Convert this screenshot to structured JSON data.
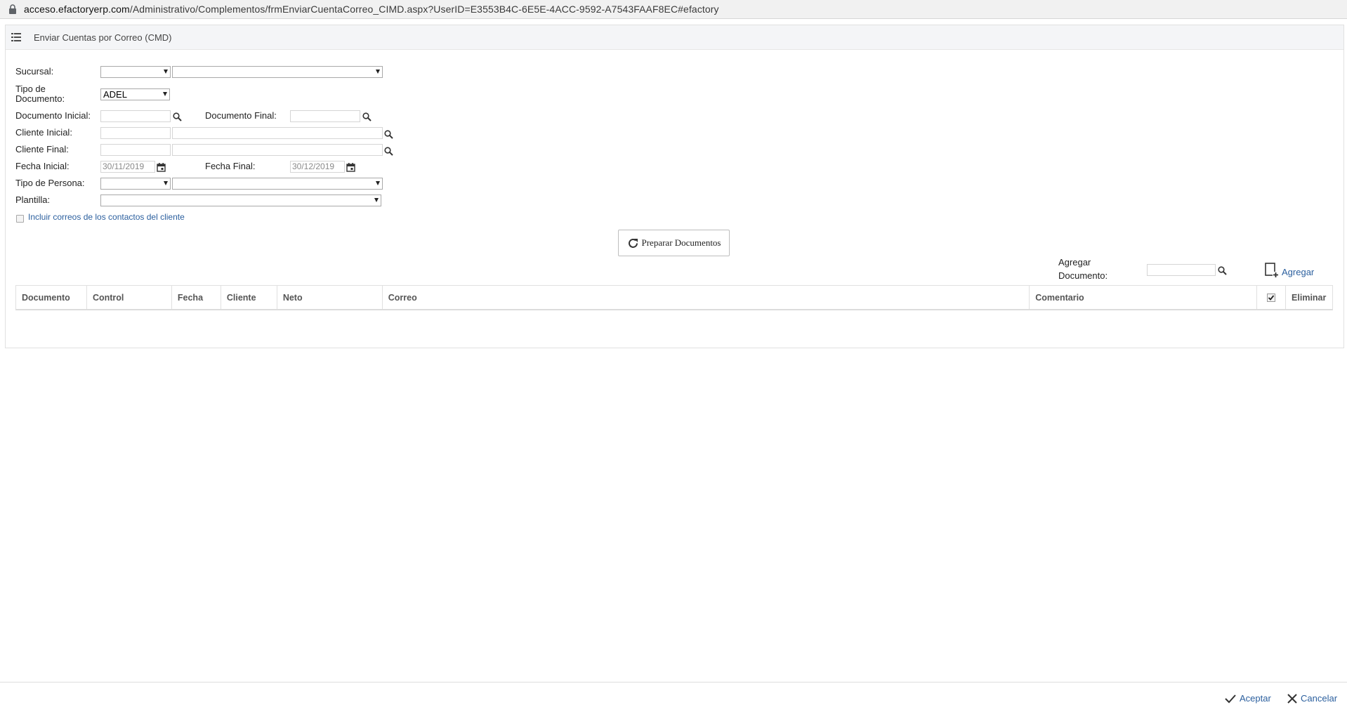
{
  "browser": {
    "url_host": "acceso.efactoryerp.com",
    "url_path": "/Administrativo/Complementos/frmEnviarCuentaCorreo_CIMD.aspx?UserID=E3553B4C-6E5E-4ACC-9592-A7543FAAF8EC#efactory"
  },
  "panel": {
    "title": "Enviar Cuentas por Correo (CMD)"
  },
  "form": {
    "sucursal_label": "Sucursal:",
    "sucursal_code": "",
    "sucursal_name": "",
    "tipo_documento_label_1": "Tipo de",
    "tipo_documento_label_2": "Documento:",
    "tipo_documento_value": "ADEL",
    "documento_inicial_label": "Documento Inicial:",
    "documento_inicial_value": "",
    "documento_final_label": "Documento Final:",
    "documento_final_value": "",
    "cliente_inicial_label": "Cliente Inicial:",
    "cliente_final_label": "Cliente Final:",
    "fecha_inicial_label": "Fecha Inicial:",
    "fecha_inicial_value": "30/11/2019",
    "fecha_final_label": "Fecha Final:",
    "fecha_final_value": "30/12/2019",
    "tipo_persona_label": "Tipo de Persona:",
    "plantilla_label": "Plantilla:",
    "incluir_correos_label": "Incluir correos de los contactos del cliente",
    "incluir_correos_checked": false
  },
  "actions": {
    "preparar_label": "Preparar Documentos",
    "agregar_documento_label_1": "Agregar",
    "agregar_documento_label_2": "Documento:",
    "agregar_label": "Agregar"
  },
  "table": {
    "columns": [
      "Documento",
      "Control",
      "Fecha",
      "Cliente",
      "Neto",
      "Correo",
      "Comentario",
      "",
      "Eliminar"
    ],
    "rows": []
  },
  "footer": {
    "aceptar_label": "Aceptar",
    "cancelar_label": "Cancelar"
  },
  "icons": {
    "menu": "list-icon",
    "search": "magnifier-icon",
    "calendar": "calendar-icon",
    "refresh": "refresh-icon",
    "add_document": "add-document-icon",
    "check": "checkmark-icon",
    "close": "x-icon"
  },
  "colors": {
    "link": "#2b5f9e",
    "header_bg": "#f4f5f7"
  }
}
